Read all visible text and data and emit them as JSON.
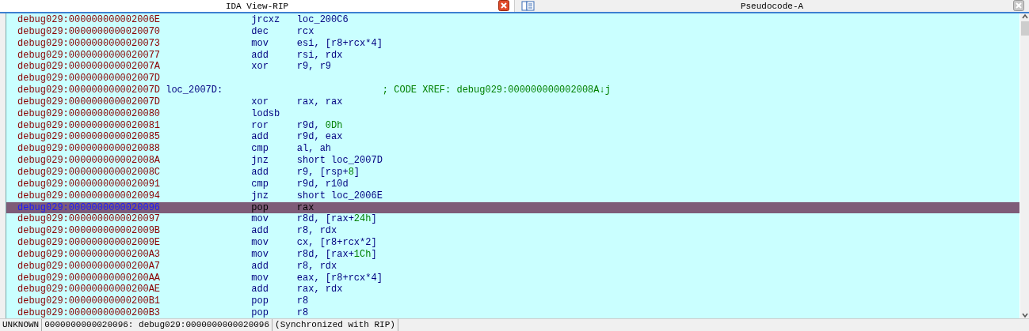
{
  "tabs": [
    {
      "title": "IDA View-RIP",
      "selected": true
    },
    {
      "title": "Pseudocode-A",
      "selected": false
    }
  ],
  "listing": [
    {
      "address": "debug029:000000000002006E",
      "mnemonic": "jrcxz",
      "operands": [
        {
          "text": "loc_200C6",
          "kind": "reg"
        }
      ],
      "selected": false
    },
    {
      "address": "debug029:0000000000020070",
      "mnemonic": "dec",
      "operands": [
        {
          "text": "rcx",
          "kind": "reg"
        }
      ],
      "selected": false
    },
    {
      "address": "debug029:0000000000020073",
      "mnemonic": "mov",
      "operands": [
        {
          "text": "esi, [r8+rcx*4]",
          "kind": "reg"
        }
      ],
      "selected": false
    },
    {
      "address": "debug029:0000000000020077",
      "mnemonic": "add",
      "operands": [
        {
          "text": "rsi, rdx",
          "kind": "reg"
        }
      ],
      "selected": false
    },
    {
      "address": "debug029:000000000002007A",
      "mnemonic": "xor",
      "operands": [
        {
          "text": "r9, r9",
          "kind": "reg"
        }
      ],
      "selected": false
    },
    {
      "address": "debug029:000000000002007D",
      "selected": false
    },
    {
      "address": "debug029:000000000002007D",
      "label": "loc_2007D:",
      "comment": "; CODE XREF: debug029:000000000002008A↓j",
      "selected": false
    },
    {
      "address": "debug029:000000000002007D",
      "mnemonic": "xor",
      "operands": [
        {
          "text": "rax, rax",
          "kind": "reg"
        }
      ],
      "selected": false
    },
    {
      "address": "debug029:0000000000020080",
      "mnemonic": "lodsb",
      "selected": false
    },
    {
      "address": "debug029:0000000000020081",
      "mnemonic": "ror",
      "operands": [
        {
          "text": "r9d, ",
          "kind": "reg"
        },
        {
          "text": "0Dh",
          "kind": "num"
        }
      ],
      "selected": false
    },
    {
      "address": "debug029:0000000000020085",
      "mnemonic": "add",
      "operands": [
        {
          "text": "r9d, eax",
          "kind": "reg"
        }
      ],
      "selected": false
    },
    {
      "address": "debug029:0000000000020088",
      "mnemonic": "cmp",
      "operands": [
        {
          "text": "al, ah",
          "kind": "reg"
        }
      ],
      "selected": false
    },
    {
      "address": "debug029:000000000002008A",
      "mnemonic": "jnz",
      "operands": [
        {
          "text": "short loc_2007D",
          "kind": "reg"
        }
      ],
      "selected": false
    },
    {
      "address": "debug029:000000000002008C",
      "mnemonic": "add",
      "operands": [
        {
          "text": "r9, [rsp+",
          "kind": "reg"
        },
        {
          "text": "8",
          "kind": "num"
        },
        {
          "text": "]",
          "kind": "reg"
        }
      ],
      "selected": false
    },
    {
      "address": "debug029:0000000000020091",
      "mnemonic": "cmp",
      "operands": [
        {
          "text": "r9d, r10d",
          "kind": "reg"
        }
      ],
      "selected": false
    },
    {
      "address": "debug029:0000000000020094",
      "mnemonic": "jnz",
      "operands": [
        {
          "text": "short loc_2006E",
          "kind": "reg"
        }
      ],
      "selected": false
    },
    {
      "address": "debug029:0000000000020096",
      "mnemonic": "pop",
      "operands": [
        {
          "text": "rax",
          "kind": "reg"
        }
      ],
      "selected": true
    },
    {
      "address": "debug029:0000000000020097",
      "mnemonic": "mov",
      "operands": [
        {
          "text": "r8d, [rax+",
          "kind": "reg"
        },
        {
          "text": "24h",
          "kind": "num"
        },
        {
          "text": "]",
          "kind": "reg"
        }
      ],
      "selected": false
    },
    {
      "address": "debug029:000000000002009B",
      "mnemonic": "add",
      "operands": [
        {
          "text": "r8, rdx",
          "kind": "reg"
        }
      ],
      "selected": false
    },
    {
      "address": "debug029:000000000002009E",
      "mnemonic": "mov",
      "operands": [
        {
          "text": "cx, [r8+rcx*2]",
          "kind": "reg"
        }
      ],
      "selected": false
    },
    {
      "address": "debug029:00000000000200A3",
      "mnemonic": "mov",
      "operands": [
        {
          "text": "r8d, [rax+",
          "kind": "reg"
        },
        {
          "text": "1Ch",
          "kind": "num"
        },
        {
          "text": "]",
          "kind": "reg"
        }
      ],
      "selected": false
    },
    {
      "address": "debug029:00000000000200A7",
      "mnemonic": "add",
      "operands": [
        {
          "text": "r8, rdx",
          "kind": "reg"
        }
      ],
      "selected": false
    },
    {
      "address": "debug029:00000000000200AA",
      "mnemonic": "mov",
      "operands": [
        {
          "text": "eax, [r8+rcx*4]",
          "kind": "reg"
        }
      ],
      "selected": false
    },
    {
      "address": "debug029:00000000000200AE",
      "mnemonic": "add",
      "operands": [
        {
          "text": "rax, rdx",
          "kind": "reg"
        }
      ],
      "selected": false
    },
    {
      "address": "debug029:00000000000200B1",
      "mnemonic": "pop",
      "operands": [
        {
          "text": "r8",
          "kind": "reg"
        }
      ],
      "selected": false
    },
    {
      "address": "debug029:00000000000200B3",
      "mnemonic": "pop",
      "operands": [
        {
          "text": "r8",
          "kind": "reg"
        }
      ],
      "selected": false
    }
  ],
  "status_bar": [
    "UNKNOWN",
    "0000000000020096: debug029:0000000000020096",
    "(Synchronized with RIP)"
  ]
}
